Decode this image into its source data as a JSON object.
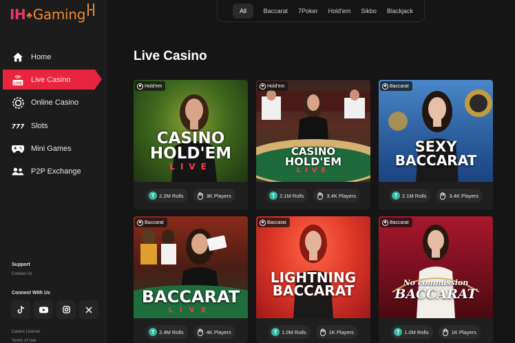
{
  "brand": {
    "ih": "IH",
    "club": "♣",
    "gaming": "Gaming"
  },
  "sidebar": {
    "items": [
      {
        "label": "Home",
        "icon": "home-icon"
      },
      {
        "label": "Live Casino",
        "icon": "live-icon"
      },
      {
        "label": "Online Casino",
        "icon": "casino-chip-icon"
      },
      {
        "label": "Slots",
        "icon": "slots-icon"
      },
      {
        "label": "Mini Games",
        "icon": "gamepad-icon"
      },
      {
        "label": "P2P Exchange",
        "icon": "users-icon"
      }
    ],
    "support_heading": "Support",
    "contact_link": "Contact Us",
    "connect_heading": "Connect With Us",
    "socials": [
      "tiktok-icon",
      "youtube-icon",
      "instagram-icon",
      "x-icon"
    ],
    "license_link": "Casino License",
    "terms_link": "Terms of Use"
  },
  "tabs": [
    "All",
    "Baccarat",
    "7Poker",
    "Hold'em",
    "Sikbo",
    "Blackjack"
  ],
  "page_title": "Live Casino",
  "cards": [
    {
      "category": "Hold'em",
      "logo": [
        "CASINO",
        "HOLD'EM",
        "LIVE"
      ],
      "rolls": "2.2M Rolls",
      "players": "3K Players"
    },
    {
      "category": "Hold'em",
      "logo": [
        "CASINO",
        "HOLD'EM",
        "LIVE"
      ],
      "rolls": "2.1M Rolls",
      "players": "3.4K Players"
    },
    {
      "category": "Baccarat",
      "logo": [
        "SEXY",
        "BACCARAT"
      ],
      "rolls": "2.1M Rolls",
      "players": "3.4K Players"
    },
    {
      "category": "Baccarat",
      "logo": [
        "BACCARAT",
        "LIVE"
      ],
      "rolls": "2.4M Rolls",
      "players": "4K Players"
    },
    {
      "category": "Baccarat",
      "logo": [
        "LIGHTNING",
        "BACCARAT"
      ],
      "rolls": "1.0M Rolls",
      "players": "1K Players"
    },
    {
      "category": "Baccarat",
      "logo": [
        "No commission",
        "BACCARAT"
      ],
      "rolls": "1.0M Rolls",
      "players": "1K Players"
    }
  ],
  "colors": {
    "accent": "#e8243e",
    "coin": "#2fb89c",
    "background": "#151515"
  }
}
